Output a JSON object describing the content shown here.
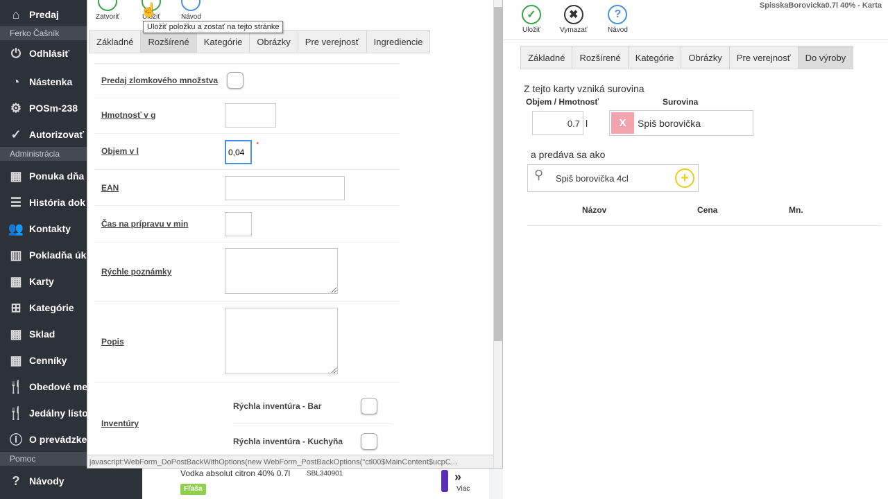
{
  "sidebar": {
    "items": [
      {
        "label": "Predaj",
        "icon": "home-icon"
      },
      {
        "label": "Odhlásiť",
        "icon": "power-icon"
      },
      {
        "label": "Nástenka",
        "icon": "dashboard-icon"
      },
      {
        "label": "POSm-238",
        "icon": "gear-icon"
      },
      {
        "label": "Autorizovať",
        "icon": "check-circle-icon"
      },
      {
        "label": "Ponuka dňa",
        "icon": "cubes-star-icon"
      },
      {
        "label": "História dok",
        "icon": "list-icon"
      },
      {
        "label": "Kontakty",
        "icon": "users-icon"
      },
      {
        "label": "Pokladňa úk",
        "icon": "bar-chart-icon"
      },
      {
        "label": "Karty",
        "icon": "cubes-icon"
      },
      {
        "label": "Kategórie",
        "icon": "tree-icon"
      },
      {
        "label": "Sklad",
        "icon": "cubes-icon"
      },
      {
        "label": "Cenníky",
        "icon": "cubes-icon"
      },
      {
        "label": "Obedové me",
        "icon": "cutlery-icon"
      },
      {
        "label": "Jedálny lísto",
        "icon": "cutlery-icon"
      },
      {
        "label": "O prevádzke",
        "icon": "info-icon"
      },
      {
        "label": "Návody",
        "icon": "help-icon"
      }
    ],
    "headers": {
      "user": "Ferko Čašník",
      "admin": "Administrácia",
      "help": "Pomoc"
    }
  },
  "modal": {
    "toolbar": {
      "close": "Zatvoriť",
      "save": "Uložiť",
      "guide": "Návod"
    },
    "tooltip": "Uložiť položku a zostať na tejto stránke",
    "tabs": [
      "Základné",
      "Rozšírené",
      "Kategórie",
      "Obrázky",
      "Pre verejnosť",
      "Ingrediencie"
    ],
    "active_tab": "Rozšírené",
    "fields": {
      "fraction_label": "Predaj zlomkového množstva",
      "weight_label": "Hmotnosť v g",
      "weight_value": "",
      "volume_label": "Objem v l",
      "volume_value": "0,04",
      "required_mark": "*",
      "ean_label": "EAN",
      "ean_value": "",
      "prep_label": "Čas na prípravu v min",
      "prep_value": "",
      "notes_label": "Rýchle poznámky",
      "desc_label": "Popis",
      "inventory_label": "Inventúry",
      "inv_bar": "Rýchla inventúra - Bar",
      "inv_kitchen": "Rýchla inventúra - Kuchyňa"
    },
    "status_text": "javascript:WebForm_DoPostBackWithOptions(new WebForm_PostBackOptions(\"ctl00$MainContent$ucpC..."
  },
  "background": {
    "item_name": "Vodka absolut citron 40% 0.7l",
    "item_code": "SBL340901",
    "badge": "Fľaša",
    "more": "Viac"
  },
  "right": {
    "title": "SpisskaBorovicka0.7l 40% - Karta",
    "toolbar": {
      "save": "Uložiť",
      "delete": "Vymazať",
      "guide": "Návod"
    },
    "tabs": [
      "Základné",
      "Rozšírené",
      "Kategórie",
      "Obrázky",
      "Pre verejnosť",
      "Do výroby"
    ],
    "active_tab": "Do výroby",
    "raw_heading": "Z tejto karty vzniká surovina",
    "col_volume": "Objem / Hmotnosť",
    "col_material": "Surovina",
    "volume_value": "0.7",
    "volume_unit": "l",
    "material_name": "Spiš borovička",
    "sold_as": "a predáva sa ako",
    "search_value": "Spiš borovička 4cl",
    "table_headers": [
      "Názov",
      "Cena",
      "Mn."
    ]
  },
  "colors": {
    "sidebar": "#2d3138",
    "check": "#3aa346",
    "close": "#333333",
    "help": "#4a90d9",
    "remove": "#f2a3ad",
    "add": "#e8cf1c",
    "badge": "#8fd14f",
    "purple": "#5b2fb5"
  }
}
